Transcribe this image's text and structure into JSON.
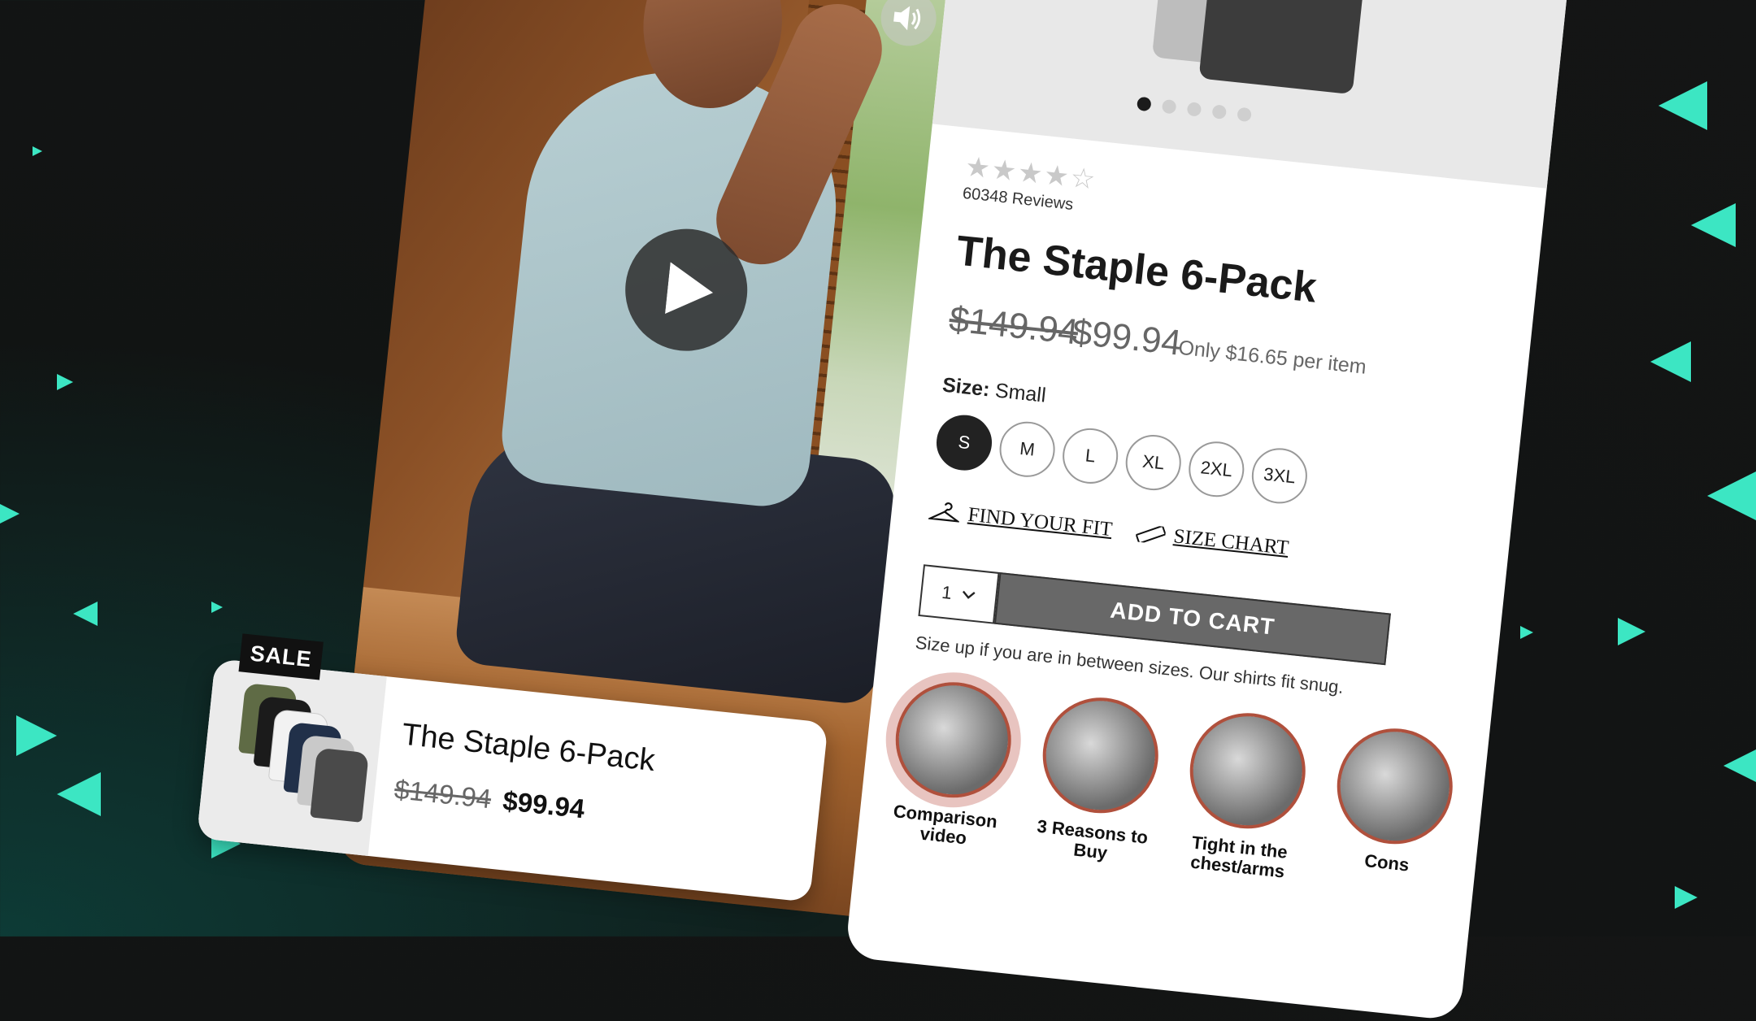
{
  "colors": {
    "accent": "#3ce6c3",
    "background": "#141515",
    "cart_button": "#686868"
  },
  "left_video": {
    "play_icon": "play-icon",
    "sound_icon": "speaker-icon"
  },
  "product_card": {
    "badge": "SALE",
    "title": "The Staple 6-Pack",
    "old_price": "$149.94",
    "new_price": "$99.94"
  },
  "product": {
    "gallery_slides": 5,
    "gallery_active": 1,
    "rating": 4.5,
    "reviews": "60348 Reviews",
    "title": "The Staple 6-Pack",
    "old_price": "$149.94",
    "new_price": "$99.94",
    "per_item": "Only $16.65 per item",
    "size_label": "Size:",
    "size_value": "Small",
    "sizes": [
      "S",
      "M",
      "L",
      "XL",
      "2XL",
      "3XL"
    ],
    "selected_size": "S",
    "find_fit": "FIND YOUR FIT",
    "size_chart": "SIZE CHART",
    "quantity": "1",
    "add_to_cart": "ADD TO CART",
    "fit_note": "Size up if you are in between sizes. Our shirts fit snug.",
    "thumbs": [
      {
        "label": "Comparison video"
      },
      {
        "label": "3 Reasons to Buy"
      },
      {
        "label": "Tight in the chest/arms"
      },
      {
        "label": "Cons"
      }
    ]
  }
}
